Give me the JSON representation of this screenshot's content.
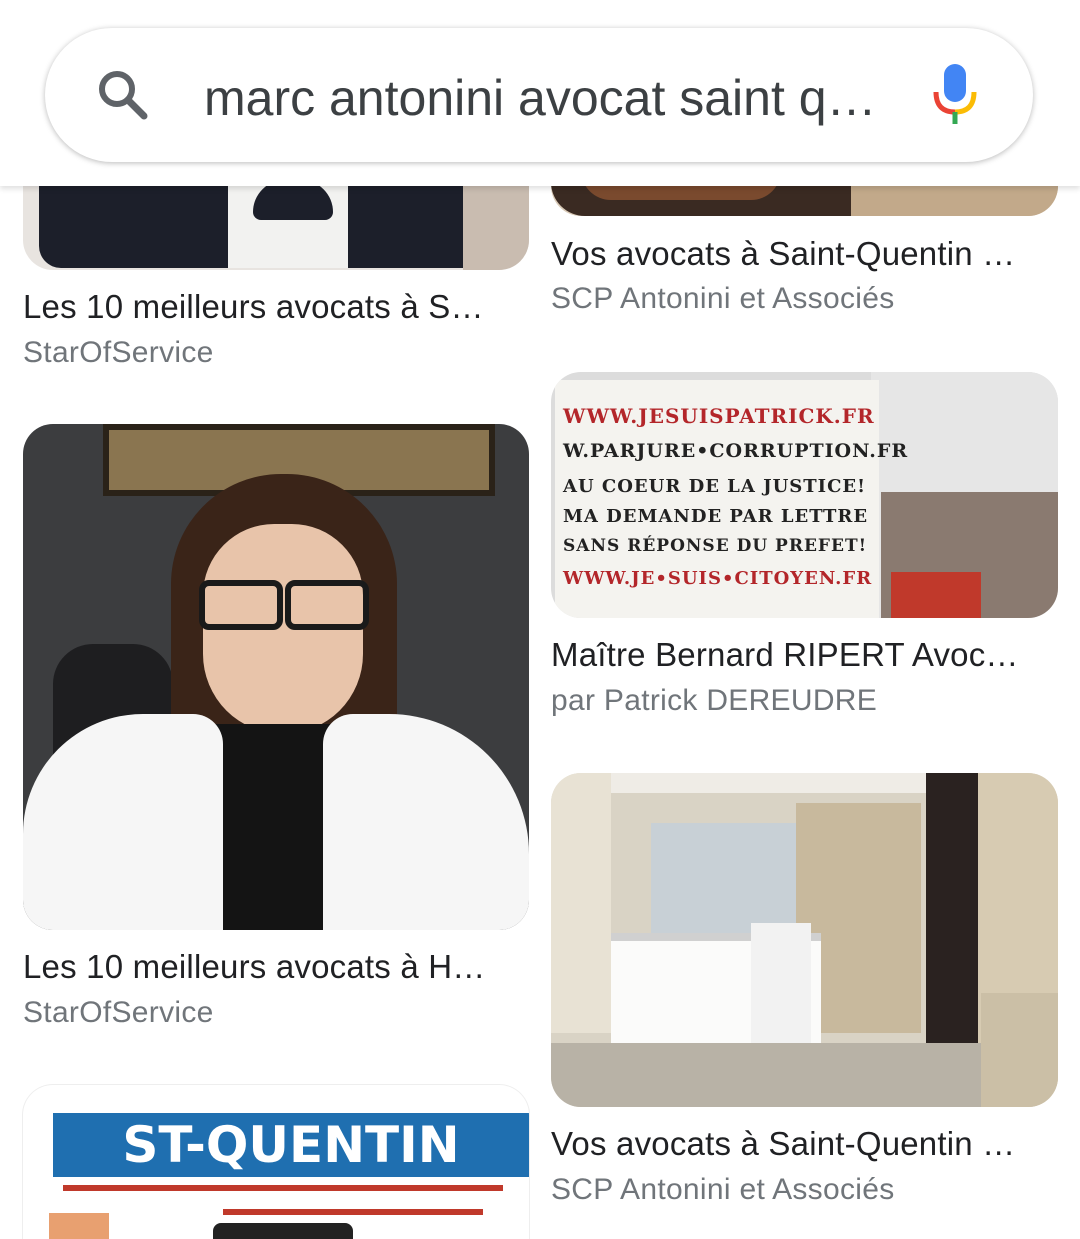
{
  "search": {
    "query": "marc antonini avocat saint q…",
    "search_icon": "search-icon",
    "mic_icon": "microphone-icon"
  },
  "results": [
    {
      "title": "Les 10 meilleurs avocats à S…",
      "source": "StarOfService"
    },
    {
      "title": "Vos avocats à Saint-Quentin …",
      "source": "SCP Antonini et Associés"
    },
    {
      "title": "Maître Bernard RIPERT Avoc…",
      "source": "par Patrick DEREUDRE"
    },
    {
      "title": "Les 10 meilleurs avocats à H…",
      "source": "StarOfService"
    },
    {
      "title": "Vos avocats à Saint-Quentin …",
      "source": "SCP Antonini et Associés"
    },
    {
      "title": "",
      "source": ""
    }
  ],
  "sign_text": {
    "line1": "WWW.JESUISPATRICK.FR",
    "line2": "W.PARJURE•CORRUPTION.FR",
    "line3": "AU COEUR DE LA JUSTICE!",
    "line4": "MA DEMANDE PAR LETTRE",
    "line5": "SANS RÉPONSE DU PREFET!",
    "line6": "WWW.JE•SUIS•CITOYEN.FR"
  },
  "magazine": {
    "title": "ST-QUENTIN MAG"
  },
  "colors": {
    "title_text": "#202124",
    "source_text": "#70757a",
    "search_text": "#3c4043",
    "mag_blue": "#1f6fb0",
    "sign_red": "#b3262a"
  }
}
